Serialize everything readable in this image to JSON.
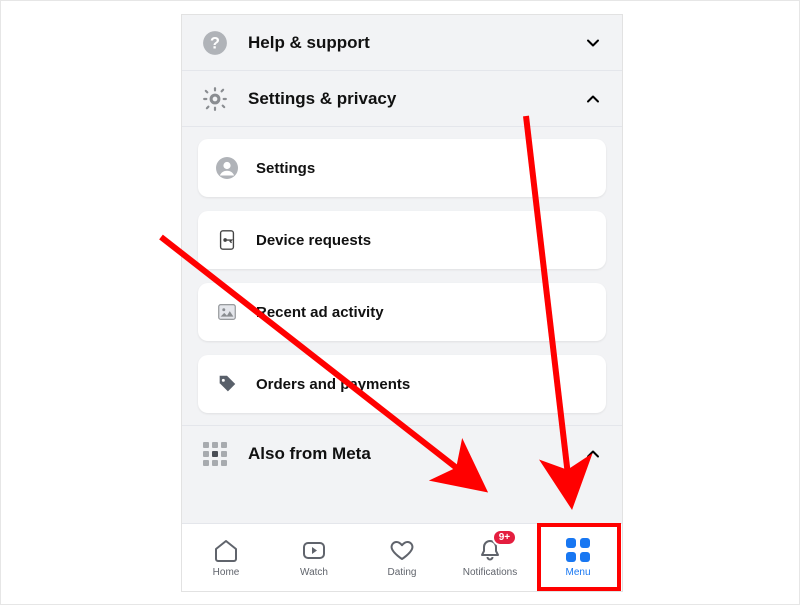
{
  "sections": {
    "help": {
      "label": "Help & support",
      "expanded": false
    },
    "settings_privacy": {
      "label": "Settings & privacy",
      "expanded": true,
      "items": [
        {
          "label": "Settings"
        },
        {
          "label": "Device requests"
        },
        {
          "label": "Recent ad activity"
        },
        {
          "label": "Orders and payments"
        }
      ]
    },
    "also_from_meta": {
      "label": "Also from Meta",
      "expanded": true
    }
  },
  "bottom_nav": {
    "items": [
      {
        "label": "Home"
      },
      {
        "label": "Watch"
      },
      {
        "label": "Dating"
      },
      {
        "label": "Notifications",
        "badge": "9+"
      },
      {
        "label": "Menu"
      }
    ],
    "active_index": 4
  },
  "colors": {
    "accent": "#1877f2",
    "annotation": "#ff0000",
    "badge": "#e41e3f"
  }
}
